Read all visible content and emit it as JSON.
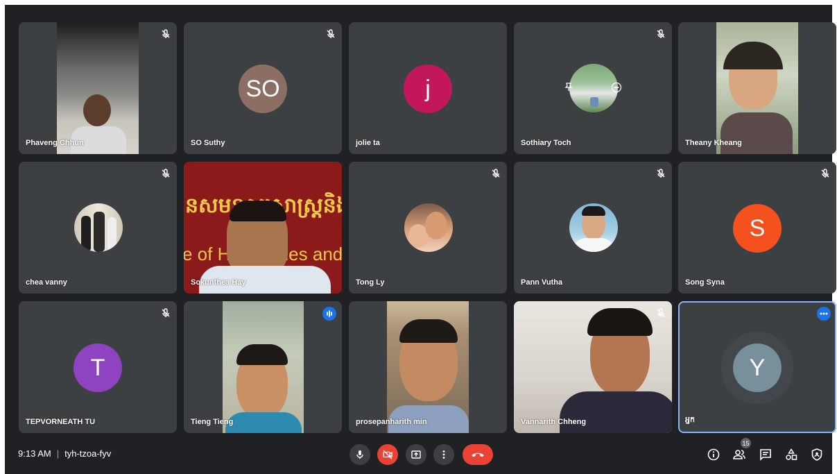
{
  "meeting": {
    "time": "9:13 AM",
    "separator": "|",
    "code": "tyh-tzoa-fyv",
    "participant_count": "15"
  },
  "participants": [
    {
      "name": "Phaveng Chhun",
      "muted": true,
      "kind": "video"
    },
    {
      "name": "SO Suthy",
      "muted": true,
      "kind": "initials",
      "initials": "SO",
      "color": "#8d6e63"
    },
    {
      "name": "jolie ta",
      "muted": false,
      "kind": "initials",
      "initials": "j",
      "color": "#c2185b"
    },
    {
      "name": "Sothiary Toch",
      "muted": true,
      "kind": "photo"
    },
    {
      "name": "Theany Kheang",
      "muted": false,
      "kind": "video"
    },
    {
      "name": "chea vanny",
      "muted": true,
      "kind": "photo"
    },
    {
      "name": "Sokunthea Hay",
      "muted": false,
      "kind": "video"
    },
    {
      "name": "Tong Ly",
      "muted": true,
      "kind": "photo"
    },
    {
      "name": "Pann Vutha",
      "muted": true,
      "kind": "photo"
    },
    {
      "name": "Song Syna",
      "muted": true,
      "kind": "initials",
      "initials": "S",
      "color": "#f4511e"
    },
    {
      "name": "TEPVORNEATH TU",
      "muted": true,
      "kind": "initials",
      "initials": "T",
      "color": "#8e44c1"
    },
    {
      "name": "Tieng Tieng",
      "muted": false,
      "kind": "video",
      "speaking": true
    },
    {
      "name": "prosepanharith min",
      "muted": false,
      "kind": "video"
    },
    {
      "name": "Vannarith Chheng",
      "muted": true,
      "kind": "video"
    },
    {
      "name": "អ្នក",
      "muted": false,
      "kind": "initials",
      "initials": "Y",
      "color": "#78909c",
      "self": true
    }
  ],
  "backdrop_text": {
    "line1": "នសមនុស្សសាស្ត្រនិងវ",
    "line2": "e of Humanities and"
  },
  "colors": {
    "background": "#202124",
    "tile": "#3c4043",
    "hangup": "#ea4335",
    "accent": "#1a73e8"
  },
  "icons": {
    "mic_muted": "mic-off-icon",
    "speaking": "audio-bars-icon",
    "more": "more-horiz-icon"
  }
}
